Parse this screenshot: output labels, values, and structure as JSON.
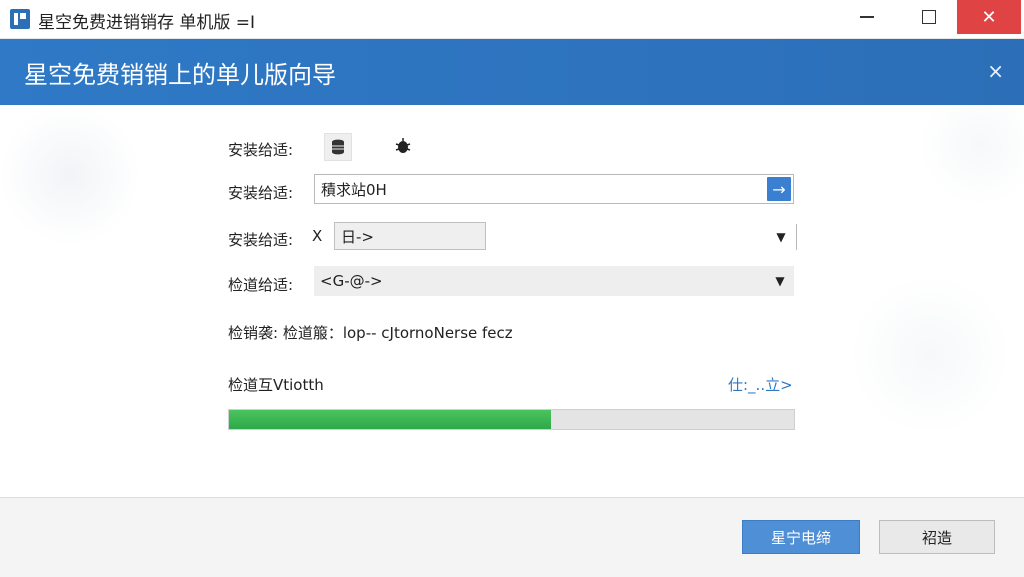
{
  "window": {
    "title": "星空免费进销销存 单机版 =I",
    "close_glyph": "✕"
  },
  "header": {
    "title": "星空免费销销上的单儿版向导",
    "close_glyph": "×"
  },
  "form": {
    "row1": {
      "label": "安装给适:",
      "icons": [
        "database-icon",
        "bug-icon"
      ]
    },
    "row2": {
      "label": "安装给适:",
      "value": "積求站0H",
      "go_glyph": "→"
    },
    "row3": {
      "label": "安装给适:",
      "x_text": "X",
      "value": "日->",
      "arrow_glyph": "▼"
    },
    "row4": {
      "label": "检道给适:",
      "value": "<G-@->",
      "arrow_glyph": "▼"
    },
    "info_text": "检销袭:  检道箙：lop-- cJtornoNerse   fecz",
    "progress_label": "检道互Vtiotth",
    "link_text": "仕:_..立>",
    "progress": 0.57
  },
  "footer": {
    "primary_label": "星宁电缔",
    "secondary_label": "袑造"
  },
  "colors": {
    "header_blue": "#2f79c6",
    "primary_button": "#4f8fd6",
    "progress_green": "#3bb454",
    "close_red": "#e04343"
  }
}
